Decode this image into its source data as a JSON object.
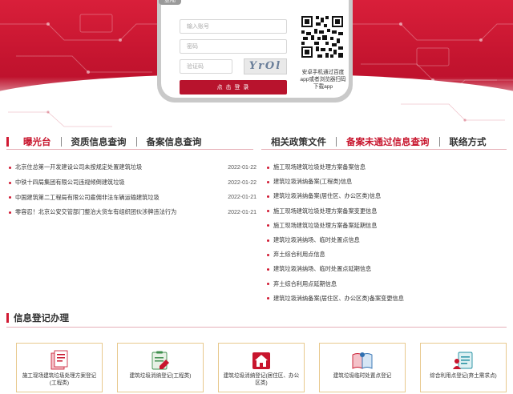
{
  "login": {
    "tab_label": "登陆",
    "account_placeholder": "输入账号",
    "password_placeholder": "密码",
    "captcha_placeholder": "验证码",
    "captcha_text": "YrOl",
    "submit_label": "点 击 登 录",
    "qr_caption": "安卓手机通过百度app或者浏览器扫码下载app"
  },
  "left_tabs": [
    {
      "label": "曝光台",
      "active": true
    },
    {
      "label": "资质信息查询",
      "active": false
    },
    {
      "label": "备案信息查询",
      "active": false
    }
  ],
  "right_tabs": [
    {
      "label": "相关政策文件",
      "active": false
    },
    {
      "label": "备案未通过信息查询",
      "active": true
    },
    {
      "label": "联络方式",
      "active": false
    }
  ],
  "news": [
    {
      "title": "北京住总第一开发建设公司未按规定处置建筑垃圾",
      "date": "2022-01-22"
    },
    {
      "title": "中铁十四局集团有限公司违规倾倒建筑垃圾",
      "date": "2022-01-22"
    },
    {
      "title": "中国建筑第二工程局有限公司雇佣非法车辆运输建筑垃圾",
      "date": "2022-01-21"
    },
    {
      "title": "零容忍！北京公安交管部门整治大货车有组织团伙涉牌违法行为",
      "date": "2022-01-21"
    }
  ],
  "policy": [
    "施工现场建筑垃圾处理方案备案信息",
    "建筑垃圾消纳备案(工程类)信息",
    "建筑垃圾消纳备案(居住区、办公区类)信息",
    "施工现场建筑垃圾处理方案备案变更信息",
    "施工现场建筑垃圾处理方案备案延期信息",
    "建筑垃圾消纳场、临时处置点信息",
    "弃土综合利用点信息",
    "建筑垃圾消纳场、临时处置点延期信息",
    "弃土综合利用点延期信息",
    "建筑垃圾消纳备案(居住区、办公区类)备案变更信息"
  ],
  "section": {
    "title": "信息登记办理"
  },
  "cards": [
    {
      "label": "施工现场建筑垃圾处理方案登记(工程类)",
      "icon": "document-stack-icon"
    },
    {
      "label": "建筑垃圾消纳登记(工程类)",
      "icon": "clipboard-pen-icon"
    },
    {
      "label": "建筑垃圾消纳登记(居住区、办公区类)",
      "icon": "house-icon"
    },
    {
      "label": "建筑垃圾临时处置点登记",
      "icon": "book-icon"
    },
    {
      "label": "综合利用点登记(弃土需求点)",
      "icon": "person-document-icon"
    }
  ],
  "colors": {
    "brand_red": "#c8152d",
    "card_border": "#e8c98e"
  }
}
